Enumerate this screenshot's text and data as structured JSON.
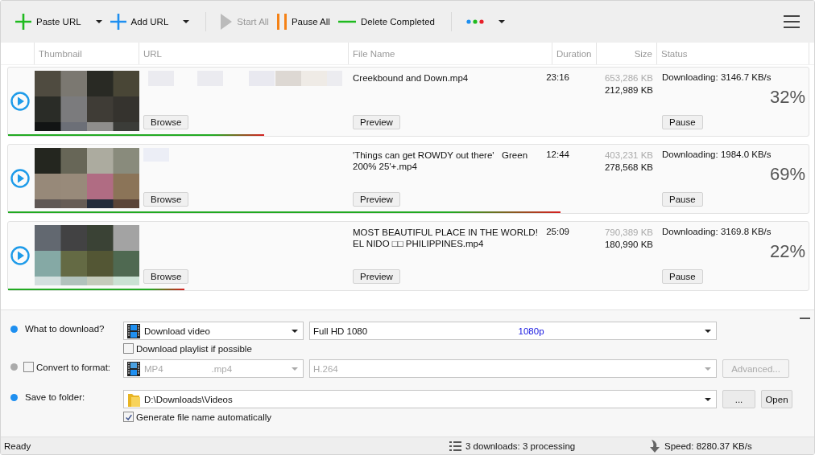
{
  "toolbar": [
    {
      "kind": "paste-url",
      "label": "Paste URL",
      "dropdown": true,
      "disabled": false
    },
    {
      "kind": "add-url",
      "label": "Add URL",
      "dropdown": true,
      "disabled": false
    },
    {
      "kind": "separator"
    },
    {
      "kind": "start-all",
      "label": "Start All",
      "dropdown": false,
      "disabled": true
    },
    {
      "kind": "pause-all",
      "label": "Pause All",
      "dropdown": false,
      "disabled": false
    },
    {
      "kind": "delete-completed",
      "label": "Delete Completed",
      "dropdown": false,
      "disabled": false
    },
    {
      "kind": "separator"
    },
    {
      "kind": "theme-menu",
      "dropdown": true,
      "disabled": false
    },
    {
      "kind": "main-menu",
      "dropdown": false,
      "disabled": false
    }
  ],
  "columns": [
    "Thumbnail",
    "URL",
    "File Name",
    "Duration",
    "Size",
    "Status"
  ],
  "downloads": [
    {
      "file_name": "Creekbound and Down.mp4",
      "duration": "23:16",
      "total_size": "653,286 KB",
      "downloaded": "212,989 KB",
      "status": "Downloading: 3146.7 KB/s",
      "percent": "32%",
      "level": 0.32,
      "browse_button": "Browse",
      "preview_button": "Preview",
      "action_button": "Pause"
    },
    {
      "file_name": "'Things can get ROWDY out there'   Green 200% 25'+.mp4",
      "duration": "12:44",
      "total_size": "403,231 KB",
      "downloaded": "278,568 KB",
      "status": "Downloading: 1984.0 KB/s",
      "percent": "69%",
      "level": 0.69,
      "browse_button": "Browse",
      "preview_button": "Preview",
      "action_button": "Pause"
    },
    {
      "file_name": "MOST BEAUTIFUL PLACE IN THE WORLD! EL NIDO □□ PHILIPPINES.mp4",
      "duration": "25:09",
      "total_size": "790,389 KB",
      "downloaded": "180,990 KB",
      "status": "Downloading: 3169.8 KB/s",
      "percent": "22%",
      "level": 0.22,
      "browse_button": "Browse",
      "preview_button": "Preview",
      "action_button": "Pause"
    }
  ],
  "what_to_download": {
    "label": "What to download?",
    "type_value": "Download video",
    "quality_value": "Full HD 1080",
    "quality_tag": "1080p",
    "playlist_option": {
      "label": "Download playlist if possible",
      "checked": false
    }
  },
  "convert": {
    "label": "Convert to format:",
    "checked": false,
    "format_value": "MP4",
    "format_ext": ".mp4",
    "codec_value": "H.264",
    "advanced_button": "Advanced..."
  },
  "save_folder": {
    "label": "Save to folder:",
    "path": "D:\\Downloads\\Videos",
    "browse_button": "...",
    "open_button": "Open",
    "auto_name_option": {
      "label": "Generate file name automatically",
      "checked": true
    }
  },
  "status_bar": {
    "state": "Ready",
    "downloads": "3 downloads: 3 processing",
    "speed": "Speed: 8280.37 KB/s"
  }
}
